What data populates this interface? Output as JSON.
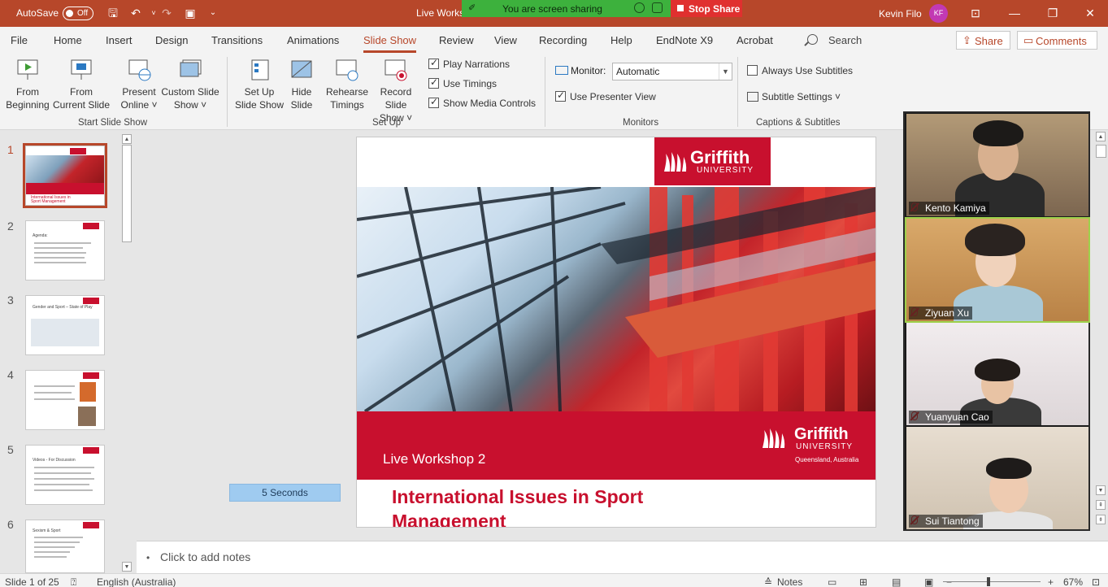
{
  "titlebar": {
    "autosave_label": "AutoSave",
    "autosave_state": "Off",
    "doc_title": "Live Works",
    "user_name": "Kevin Filo",
    "user_initials": "KF",
    "share_banner": "You are screen sharing",
    "stop_share": "Stop Share"
  },
  "tabs": [
    "File",
    "Home",
    "Insert",
    "Design",
    "Transitions",
    "Animations",
    "Slide Show",
    "Review",
    "View",
    "Recording",
    "Help",
    "EndNote X9",
    "Acrobat"
  ],
  "active_tab": "Slide Show",
  "search_label": "Search",
  "share_label": "Share",
  "comments_label": "Comments",
  "ribbon": {
    "start": {
      "from_beginning": [
        "From",
        "Beginning"
      ],
      "from_current": [
        "From",
        "Current Slide"
      ],
      "present_online": [
        "Present",
        "Online ˅"
      ],
      "custom_show": [
        "Custom Slide",
        "Show ˅"
      ],
      "group_label": "Start Slide Show"
    },
    "setup": {
      "setup_show": [
        "Set Up",
        "Slide Show"
      ],
      "hide_slide": [
        "Hide",
        "Slide"
      ],
      "rehearse": [
        "Rehearse",
        "Timings"
      ],
      "record": [
        "Record Slide",
        "Show ˅"
      ],
      "play_narrations": "Play Narrations",
      "use_timings": "Use Timings",
      "show_media": "Show Media Controls",
      "group_label": "Set Up"
    },
    "monitors": {
      "monitor_label": "Monitor:",
      "monitor_value": "Automatic",
      "presenter_view": "Use Presenter View",
      "group_label": "Monitors"
    },
    "captions": {
      "always_subtitles": "Always Use Subtitles",
      "subtitle_settings": "Subtitle Settings ˅",
      "group_label": "Captions & Subtitles"
    }
  },
  "thumbnails": {
    "numbers": [
      "1",
      "2",
      "3",
      "4",
      "5",
      "6"
    ],
    "titles": [
      "",
      "Agenda:",
      "Gender and Sport – State of Play",
      "",
      "Videos - For Discussion",
      "Sexism & Sport"
    ],
    "slide1_caption": "International Issues in Sport Management"
  },
  "slide": {
    "logo_word": "Griffith",
    "logo_sub": "UNIVERSITY",
    "logo_location": "Queensland, Australia",
    "workshop": "Live Workshop 2",
    "title": "International Issues in Sport Management"
  },
  "timing_box": "5 Seconds",
  "participants": [
    "Kento Kamiya",
    "Ziyuan Xu",
    "Yuanyuan Cao",
    "Sui Tiantong"
  ],
  "notes_placeholder": "Click to add notes",
  "status": {
    "slide_info": "Slide 1 of 25",
    "language": "English (Australia)",
    "notes_btn": "Notes",
    "zoom": "67%"
  },
  "colors": {
    "accent": "#b7472a",
    "griffith_red": "#c8102e",
    "share_green": "#3db13d",
    "stop_red": "#e0302f"
  }
}
